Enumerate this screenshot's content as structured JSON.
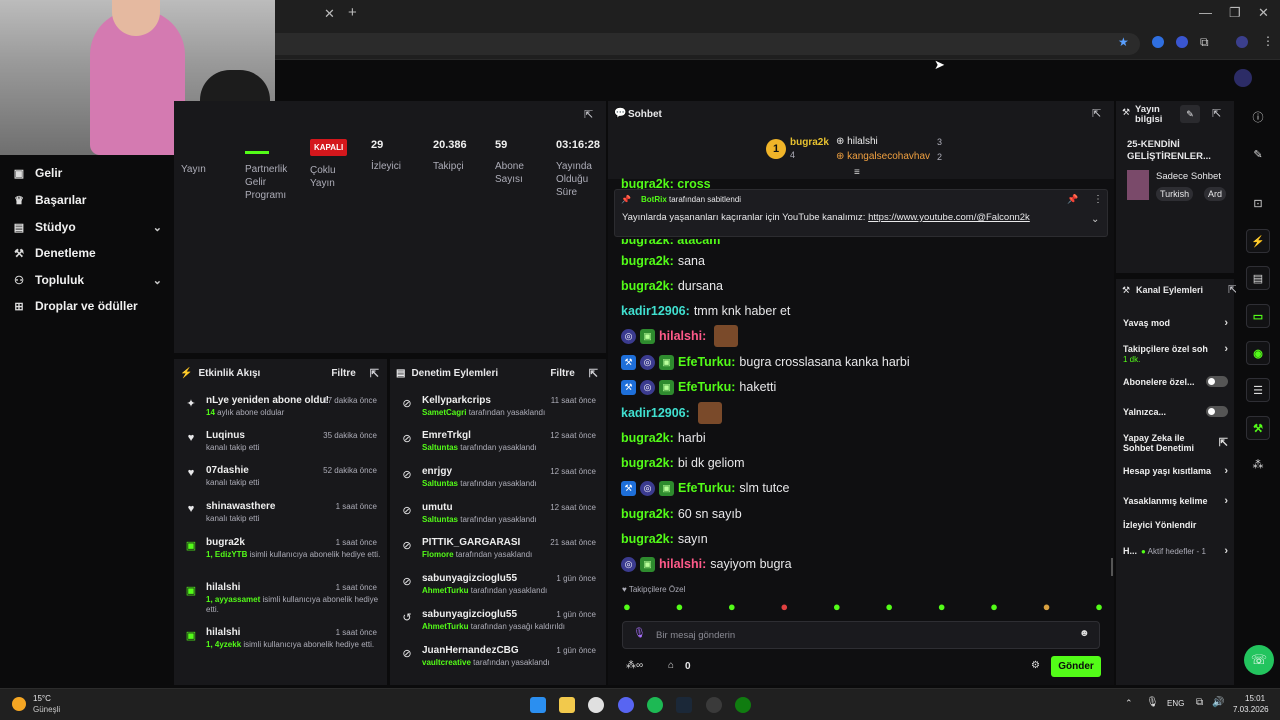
{
  "browser": {
    "close_tab": "✕",
    "new_tab": "+",
    "window_controls": [
      "—",
      "❐",
      "✕"
    ]
  },
  "sidebar": {
    "items": [
      {
        "icon": "dollar-icon",
        "label": "Gelir"
      },
      {
        "icon": "trophy-icon",
        "label": "Başarılar"
      },
      {
        "icon": "studio-icon",
        "label": "Stüdyo"
      },
      {
        "icon": "wrench-icon",
        "label": "Denetleme"
      },
      {
        "icon": "community-icon",
        "label": "Topluluk"
      },
      {
        "icon": "drops-icon",
        "label": "Droplar ve ödüller"
      }
    ]
  },
  "stats": {
    "col_yayin": "Yayın",
    "col_partner": "Partnerlik Gelir Programı",
    "badge_off": "KAPALI",
    "col_multi": "Çoklu Yayın",
    "viewers_value": "29",
    "viewers_label": "İzleyici",
    "followers_value": "20.386",
    "followers_label": "Takipçi",
    "subs_value": "59",
    "subs_label": "Abone Sayısı",
    "uptime_value": "03:16:28",
    "uptime_label": "Yayında Olduğu Süre"
  },
  "activity": {
    "title": "Etkinlik Akışı",
    "filter": "Filtre",
    "rows": [
      {
        "name": "nLye yeniden abone oldu!",
        "time": "17 dakika önce",
        "hl": "14",
        "sub": " aylık abone oldular"
      },
      {
        "name": "Luqinus",
        "time": "35 dakika önce",
        "hl": "",
        "sub": "kanalı takip etti"
      },
      {
        "name": "07dashie",
        "time": "52 dakika önce",
        "hl": "",
        "sub": "kanalı takip etti"
      },
      {
        "name": "shinawasthere",
        "time": "1 saat önce",
        "hl": "",
        "sub": "kanalı takip etti"
      },
      {
        "name": "bugra2k",
        "time": "1 saat önce",
        "hl": "1, EdizYTB",
        "sub": " isimli kullanıcıya abonelik hediye etti."
      },
      {
        "name": "hilalshi",
        "time": "1 saat önce",
        "hl": "1, ayyassamet",
        "sub": " isimli kullanıcıya abonelik hediye etti."
      },
      {
        "name": "hilalshi",
        "time": "1 saat önce",
        "hl": "1, 4yzekk",
        "sub": " isimli kullanıcıya abonelik hediye etti."
      }
    ]
  },
  "moderation": {
    "title": "Denetim Eylemleri",
    "filter": "Filtre",
    "rows": [
      {
        "name": "Kellyparkcrips",
        "time": "11 saat önce",
        "mod": "SametCagri",
        "action": " tarafından yasaklandı"
      },
      {
        "name": "EmreTrkgl",
        "time": "12 saat önce",
        "mod": "Saltuntas",
        "action": " tarafından yasaklandı"
      },
      {
        "name": "enrjgy",
        "time": "12 saat önce",
        "mod": "Saltuntas",
        "action": " tarafından yasaklandı"
      },
      {
        "name": "umutu",
        "time": "12 saat önce",
        "mod": "Saltuntas",
        "action": " tarafından yasaklandı"
      },
      {
        "name": "PITTIK_GARGARASI",
        "time": "21 saat önce",
        "mod": "Flomore",
        "action": " tarafından yasaklandı"
      },
      {
        "name": "sabunyagizcioglu55",
        "time": "1 gün önce",
        "mod": "AhmetTurku",
        "action": " tarafından yasaklandı"
      },
      {
        "name": "sabunyagizcioglu55",
        "time": "1 gün önce",
        "mod": "AhmetTurku",
        "action": " tarafından yasağı kaldırıldı"
      },
      {
        "name": "JuanHernandezCBG",
        "time": "1 gün önce",
        "mod": "vaultcreative",
        "action": " tarafından yasaklandı"
      }
    ]
  },
  "chat": {
    "title": "Sohbet",
    "top": [
      {
        "rank": "1",
        "name": "bugra2k",
        "count": "4"
      },
      {
        "name": "hilalshi",
        "count": "3"
      },
      {
        "name": "kangalsecohavhav",
        "count": "2"
      }
    ],
    "cut_line": "bugra2k: cross",
    "cut_line2": "bugra2k: atacam",
    "pinned_by_name": "BotRix",
    "pinned_by_text": " tarafından sabitlendi",
    "pinned_message": "Yayınlarda yaşananları kaçıranlar için YouTube kanalımız: ",
    "pinned_link": "https://www.youtube.com/@Falconn2k",
    "messages": [
      {
        "user": "bugra2k",
        "text": "sana",
        "cls": "u-g",
        "badges": []
      },
      {
        "user": "bugra2k",
        "text": "dursana",
        "cls": "u-g",
        "badges": []
      },
      {
        "user": "kadir12906",
        "text": "tmm knk haber et",
        "cls": "u-t",
        "badges": []
      },
      {
        "user": "hilalshi",
        "text": "",
        "cls": "u-p",
        "badges": [
          "og",
          "sub"
        ],
        "emote": true
      },
      {
        "user": "EfeTurku",
        "text": "bugra crosslasana kanka harbi",
        "cls": "u-g",
        "badges": [
          "mod",
          "og",
          "sub"
        ]
      },
      {
        "user": "EfeTurku",
        "text": "haketti",
        "cls": "u-g",
        "badges": [
          "mod",
          "og",
          "sub"
        ]
      },
      {
        "user": "kadir12906",
        "text": "",
        "cls": "u-t",
        "badges": [],
        "emote": true
      },
      {
        "user": "bugra2k",
        "text": "harbi",
        "cls": "u-g",
        "badges": []
      },
      {
        "user": "bugra2k",
        "text": "bi dk geliom",
        "cls": "u-g",
        "badges": []
      },
      {
        "user": "EfeTurku",
        "text": "slm tutce",
        "cls": "u-g",
        "badges": [
          "mod",
          "og",
          "sub"
        ]
      },
      {
        "user": "bugra2k",
        "text": "60 sn sayıb",
        "cls": "u-g",
        "badges": []
      },
      {
        "user": "bugra2k",
        "text": "sayın",
        "cls": "u-g",
        "badges": []
      },
      {
        "user": "hilalshi",
        "text": "sayiyom bugra",
        "cls": "u-p",
        "badges": [
          "og",
          "sub"
        ]
      }
    ],
    "followers_only": "Takipçilere Özel",
    "input_placeholder": "Bir mesaj gönderin",
    "points": "0",
    "send": "Gönder"
  },
  "stream_info": {
    "title": "Yayın bilgisi",
    "stream_title": "25-KENDİNİ GELİŞTİRENLER...",
    "category": "Sadece Sohbet",
    "tags": [
      "Turkish",
      "Ard"
    ]
  },
  "channel_actions": {
    "title": "Kanal Eylemleri",
    "slow_mode": "Yavaş mod",
    "followers_only": "Takipçilere özel soh",
    "followers_only_sub": "1 dk.",
    "subs_only": "Abonelere özel...",
    "only": "Yalnızca...",
    "ai_mod": "Yapay Zeka ile Sohbet Denetimi",
    "age_limit": "Hesap yaşı kısıtlama",
    "banned_words": "Yasaklanmış kelime",
    "redirect": "İzleyici Yönlendir",
    "goals_prefix": "H...",
    "goals": "Aktif hedefler - 1"
  },
  "taskbar": {
    "weather_temp": "15°C",
    "weather_desc": "Güneşli",
    "lang": "ENG",
    "time": "15:01",
    "date": "7.03.2026"
  },
  "colors": {
    "accent": "#53fc18",
    "danger": "#d4171c",
    "panel": "#18181b"
  }
}
